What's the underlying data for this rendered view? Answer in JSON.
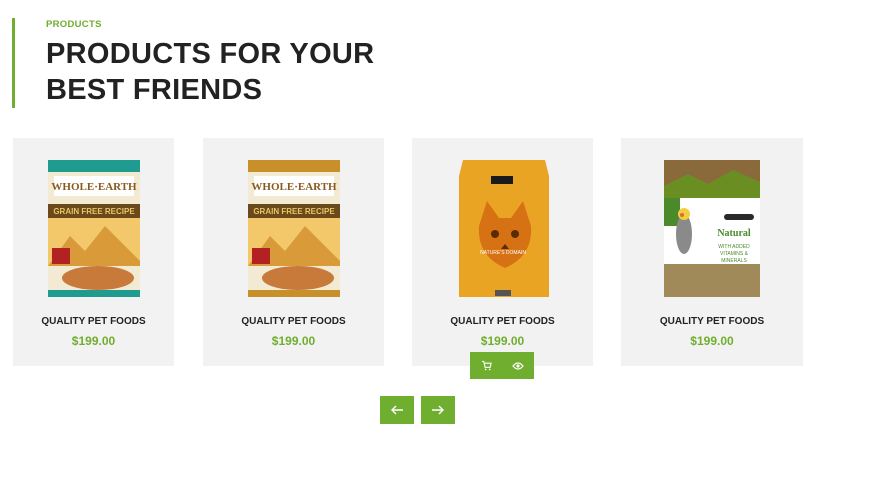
{
  "section": {
    "eyebrow": "PRODUCTS",
    "title_line1": "PRODUCTS FOR YOUR",
    "title_line2": "BEST FRIENDS"
  },
  "products": [
    {
      "name": "QUALITY PET FOODS",
      "price": "$199.00"
    },
    {
      "name": "QUALITY PET FOODS",
      "price": "$199.00"
    },
    {
      "name": "QUALITY PET FOODS",
      "price": "$199.00"
    },
    {
      "name": "QUALITY PET FOODS",
      "price": "$199.00"
    }
  ],
  "actions": {
    "cart_icon": "cart-icon",
    "view_icon": "eye-icon"
  },
  "nav": {
    "prev_icon": "arrow-left-icon",
    "next_icon": "arrow-right-icon"
  },
  "colors": {
    "accent": "#6fae2e",
    "card_bg": "#f2f2f2",
    "heading": "#222222"
  }
}
